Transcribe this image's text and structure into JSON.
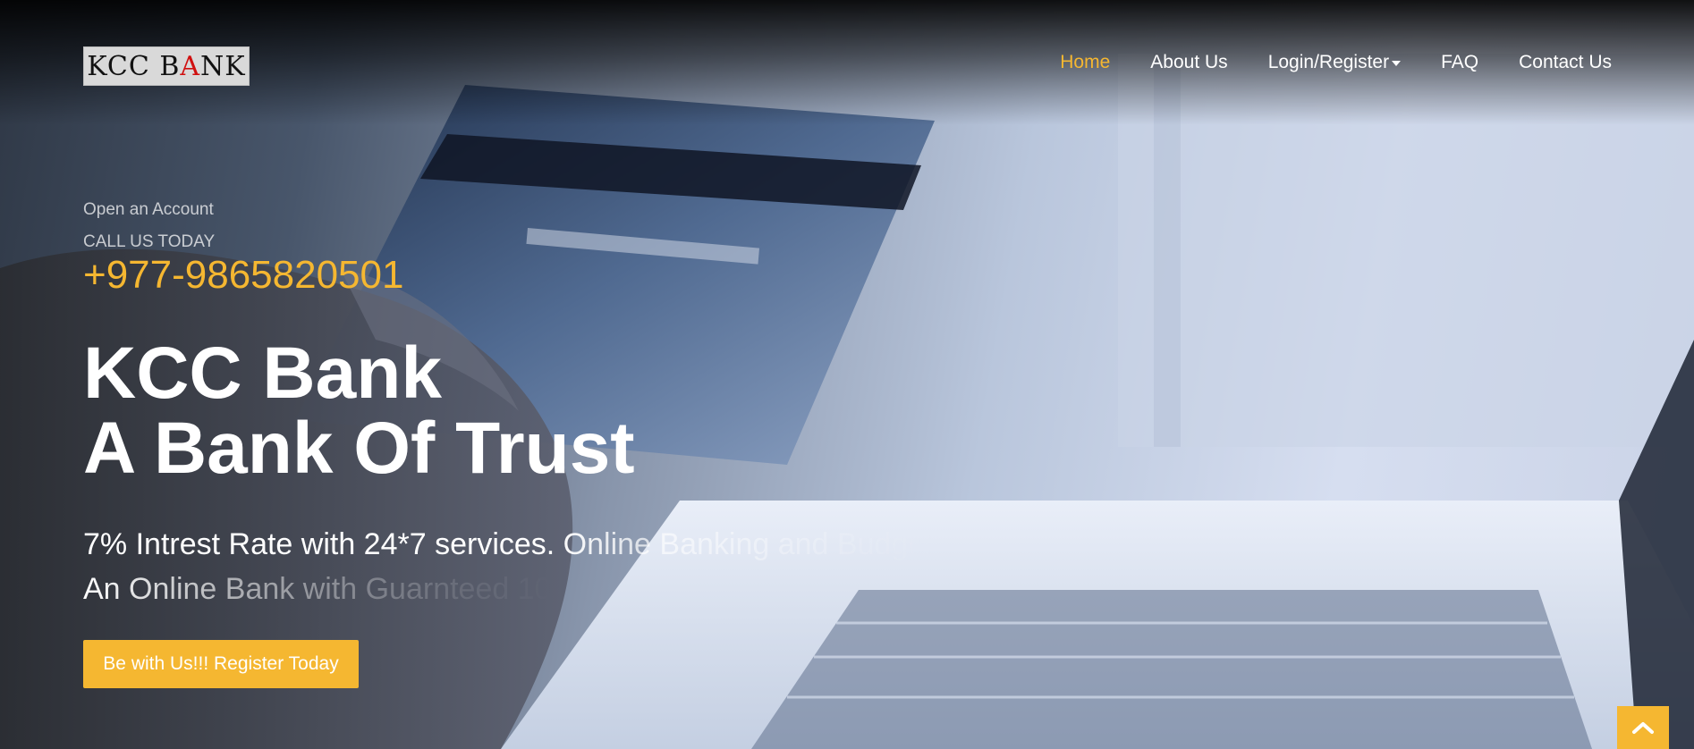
{
  "brand": {
    "logo_prefix": "KCC B",
    "logo_accent": "A",
    "logo_suffix": "NK",
    "accent_color": "#f5b731"
  },
  "nav": {
    "items": [
      {
        "label": "Home",
        "active": true
      },
      {
        "label": "About Us",
        "active": false
      },
      {
        "label": "Login/Register",
        "active": false,
        "has_dropdown": true
      },
      {
        "label": "FAQ",
        "active": false
      },
      {
        "label": "Contact Us",
        "active": false
      }
    ]
  },
  "hero": {
    "open_account": "Open an Account",
    "call_label": "CALL US TODAY",
    "phone": "+977-9865820501",
    "headline_line1": "KCC Bank",
    "headline_line2": "A Bank Of Trust",
    "subline1_visible": "7% Intrest Rate with 24*7 services.",
    "subline1_faded": " Online Banking and Budget",
    "subline2_visible": "An Online Bank with Guarnteed 10",
    "cta_label": "Be with Us!!! Register Today"
  },
  "back_to_top": {
    "icon": "chevron-up-icon"
  }
}
